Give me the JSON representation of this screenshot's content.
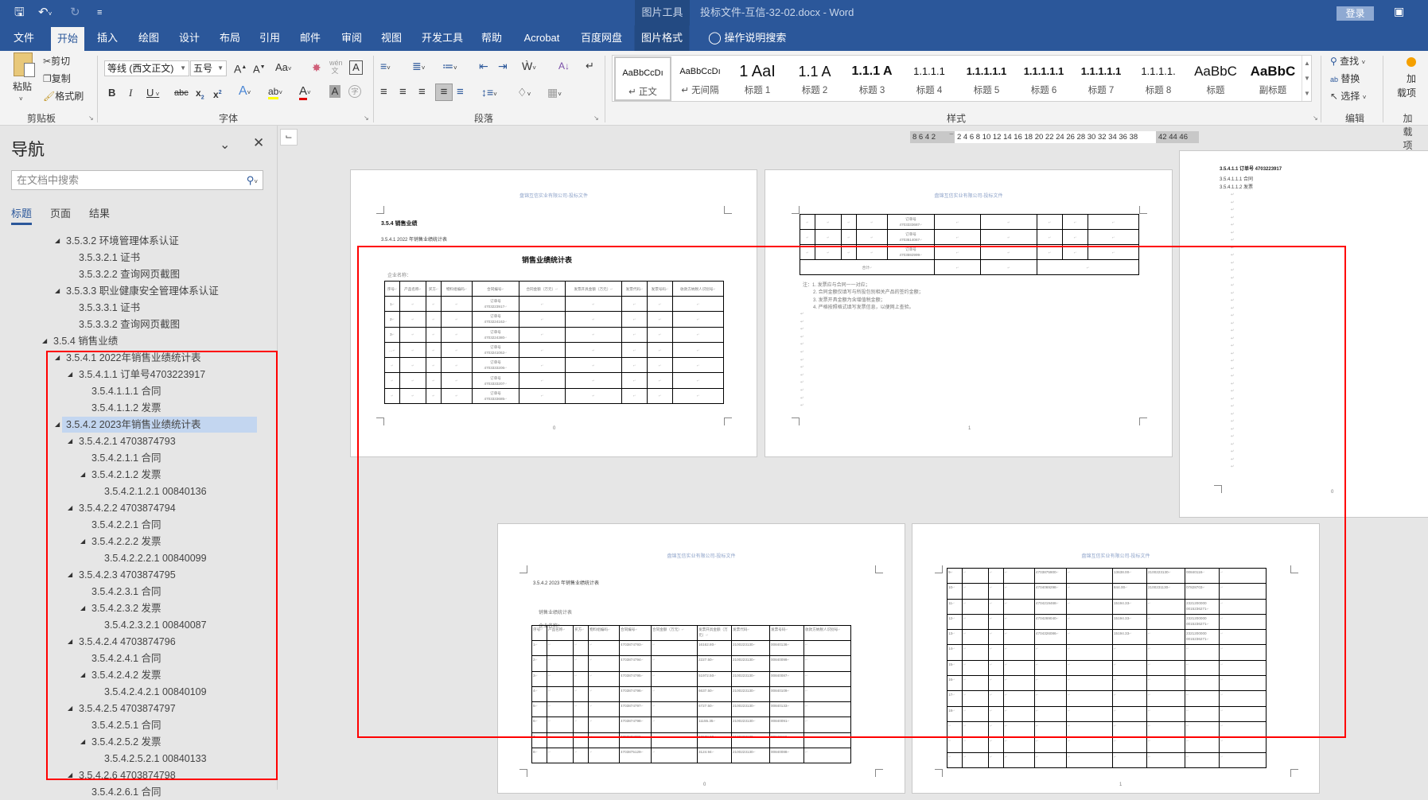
{
  "titlebar": {
    "context_tool": "图片工具",
    "doc_title": "投标文件-互信-32-02.docx  -  Word",
    "login": "登录"
  },
  "tabs": [
    "文件",
    "开始",
    "插入",
    "绘图",
    "设计",
    "布局",
    "引用",
    "邮件",
    "审阅",
    "视图",
    "开发工具",
    "帮助",
    "Acrobat",
    "百度网盘",
    "图片格式"
  ],
  "tell_me": "操作说明搜索",
  "ribbon": {
    "clipboard": {
      "label": "剪贴板",
      "paste": "粘贴",
      "cut": "剪切",
      "copy": "复制",
      "format_painter": "格式刷"
    },
    "font": {
      "label": "字体",
      "font_name": "等线 (西文正文)",
      "font_size": "五号"
    },
    "paragraph": {
      "label": "段落"
    },
    "styles": {
      "label": "样式",
      "items": [
        {
          "preview": "AaBbCcDı",
          "name": "正文"
        },
        {
          "preview": "AaBbCcDı",
          "name": "无间隔"
        },
        {
          "preview": "1  AaI",
          "name": "标题 1"
        },
        {
          "preview": "1.1  A",
          "name": "标题 2"
        },
        {
          "preview": "1.1.1  A",
          "name": "标题 3"
        },
        {
          "preview": "1.1.1.1",
          "name": "标题 4"
        },
        {
          "preview": "1.1.1.1.1",
          "name": "标题 5"
        },
        {
          "preview": "1.1.1.1.1",
          "name": "标题 6"
        },
        {
          "preview": "1.1.1.1.1",
          "name": "标题 7"
        },
        {
          "preview": "1.1.1.1.",
          "name": "标题 8"
        },
        {
          "preview": "AaBbC",
          "name": "标题"
        },
        {
          "preview": "AaBbC",
          "name": "副标题"
        }
      ]
    },
    "editing": {
      "label": "编辑",
      "find": "查找",
      "replace": "替换",
      "select": "选择"
    },
    "addins": {
      "label": "加载项",
      "button_line1": "加",
      "button_line2": "载项"
    }
  },
  "ruler": {
    "left": "8  6  4  2",
    "middle": "2  4  6  8  10 12 14 16 18 20 22 24 26 28 30 32 34 36 38",
    "right": "42 44 46"
  },
  "nav": {
    "title": "导航",
    "search_placeholder": "在文档中搜索",
    "tabs": [
      "标题",
      "页面",
      "结果"
    ],
    "items": [
      {
        "text": "3.5.3.2 环境管理体系认证",
        "depth": 1,
        "expandable": true
      },
      {
        "text": "3.5.3.2.1 证书",
        "depth": 2
      },
      {
        "text": "3.5.3.2.2 查询网页截图",
        "depth": 2
      },
      {
        "text": "3.5.3.3 职业健康安全管理体系认证",
        "depth": 1,
        "expandable": true
      },
      {
        "text": "3.5.3.3.1 证书",
        "depth": 2
      },
      {
        "text": "3.5.3.3.2 查询网页截图",
        "depth": 2
      },
      {
        "text": "3.5.4 销售业绩",
        "depth": 0,
        "expandable": true
      },
      {
        "text": "3.5.4.1 2022年销售业绩统计表",
        "depth": 1,
        "expandable": true
      },
      {
        "text": "3.5.4.1.1 订单号4703223917",
        "depth": 2,
        "expandable": true
      },
      {
        "text": "3.5.4.1.1.1 合同",
        "depth": 3
      },
      {
        "text": "3.5.4.1.1.2 发票",
        "depth": 3
      },
      {
        "text": "3.5.4.2 2023年销售业绩统计表",
        "depth": 1,
        "expandable": true,
        "selected": true
      },
      {
        "text": "3.5.4.2.1 4703874793",
        "depth": 2,
        "expandable": true
      },
      {
        "text": "3.5.4.2.1.1 合同",
        "depth": 3
      },
      {
        "text": "3.5.4.2.1.2 发票",
        "depth": 3,
        "expandable": true
      },
      {
        "text": "3.5.4.2.1.2.1 00840136",
        "depth": 4
      },
      {
        "text": "3.5.4.2.2 4703874794",
        "depth": 2,
        "expandable": true
      },
      {
        "text": "3.5.4.2.2.1 合同",
        "depth": 3
      },
      {
        "text": "3.5.4.2.2.2 发票",
        "depth": 3,
        "expandable": true
      },
      {
        "text": "3.5.4.2.2.2.1 00840099",
        "depth": 4
      },
      {
        "text": "3.5.4.2.3 4703874795",
        "depth": 2,
        "expandable": true
      },
      {
        "text": "3.5.4.2.3.1 合同",
        "depth": 3
      },
      {
        "text": "3.5.4.2.3.2 发票",
        "depth": 3,
        "expandable": true
      },
      {
        "text": "3.5.4.2.3.2.1 00840087",
        "depth": 4
      },
      {
        "text": "3.5.4.2.4 4703874796",
        "depth": 2,
        "expandable": true
      },
      {
        "text": "3.5.4.2.4.1 合同",
        "depth": 3
      },
      {
        "text": "3.5.4.2.4.2 发票",
        "depth": 3,
        "expandable": true
      },
      {
        "text": "3.5.4.2.4.2.1 00840109",
        "depth": 4
      },
      {
        "text": "3.5.4.2.5 4703874797",
        "depth": 2,
        "expandable": true
      },
      {
        "text": "3.5.4.2.5.1 合同",
        "depth": 3
      },
      {
        "text": "3.5.4.2.5.2 发票",
        "depth": 3,
        "expandable": true
      },
      {
        "text": "3.5.4.2.5.2.1 00840133",
        "depth": 4
      },
      {
        "text": "3.5.4.2.6 4703874798",
        "depth": 2,
        "expandable": true
      },
      {
        "text": "3.5.4.2.6.1 合同",
        "depth": 3
      }
    ]
  },
  "doc": {
    "header": "盘锦互信实业有限公司-投标文件",
    "page1": {
      "heading": "3.5.4   销售业绩",
      "subheading": "3.5.4.1   2022 年销售业绩统计表",
      "table_title": "销售业绩统计表",
      "company_label": "企业名称：",
      "page_number": "0",
      "table": {
        "head": [
          "序号",
          "产品名称",
          "买方",
          "物料组编码",
          "合同编号",
          "合同金额（万元）",
          "发票开具金额（万元）",
          "发票代码",
          "发票号码",
          "收款方纳税人识别号"
        ],
        "rows": [
          [
            "1",
            "",
            "",
            "",
            "订单号\n4703223917",
            "",
            "",
            "",
            "",
            ""
          ],
          [
            "2",
            "",
            "",
            "",
            "订单号\n4703224162",
            "",
            "",
            "",
            "",
            ""
          ],
          [
            "3",
            "",
            "",
            "",
            "订单号\n4703224380",
            "",
            "",
            "",
            "",
            ""
          ],
          [
            "…",
            "",
            "",
            "",
            "订单号\n4703241062",
            "",
            "",
            "",
            "",
            ""
          ],
          [
            "",
            "",
            "",
            "",
            "订单号\n4703333206",
            "",
            "",
            "",
            "",
            ""
          ],
          [
            "",
            "",
            "",
            "",
            "订单号\n4703333207",
            "",
            "",
            "",
            "",
            ""
          ],
          [
            "",
            "",
            "",
            "",
            "订单号\n4703333685",
            "",
            "",
            "",
            "",
            ""
          ]
        ]
      }
    },
    "page2": {
      "page_number": "1",
      "table": {
        "rows": [
          [
            "",
            "",
            "",
            "",
            "订单号\n4703333687",
            "",
            "",
            "",
            "",
            ""
          ],
          [
            "",
            "",
            "",
            "",
            "订单号\n4703514067",
            "",
            "",
            "",
            "",
            ""
          ],
          [
            "",
            "",
            "",
            "",
            "订单号\n4703592999",
            "",
            "",
            "",
            "",
            ""
          ]
        ],
        "total_label": "合计"
      },
      "notes": [
        "注：1. 发票应与合同一一对应；",
        "2. 合同金额仅填写与所投包别相关产品的签约金额；",
        "3. 发票开具金额为含增值税金额；",
        "4. 严格按照格式填写发票信息，以便网上查验。"
      ]
    },
    "page3": {
      "headings": [
        "3.5.4.1.1      订单号 4703223917",
        "3.5.4.1.1.1    合同",
        "3.5.4.1.1.2    发票"
      ],
      "page_number": "0"
    },
    "page4": {
      "heading": "3.5.4.2   2023 年销售业绩统计表",
      "table_title": "销售业绩统计表",
      "company_label": "企业名称：",
      "page_number": "0",
      "table": {
        "head": [
          "序号",
          "产品名称",
          "买方",
          "物料组编码",
          "合同编号",
          "合同金额（万元）",
          "发票开具金额（万元）",
          "发票代码",
          "发票号码",
          "收款方纳税人识别号"
        ],
        "rows": [
          [
            "1",
            "",
            "",
            "",
            "4703874793",
            "",
            "16162.80",
            "2100223130",
            "00840136",
            ""
          ],
          [
            "2",
            "",
            "",
            "",
            "4703874794",
            "",
            "2227.50",
            "2100223130",
            "00840099",
            ""
          ],
          [
            "3",
            "",
            "",
            "",
            "4703874795",
            "",
            "51972.50",
            "2100223130",
            "00840087",
            ""
          ],
          [
            "4",
            "",
            "",
            "",
            "4703874796",
            "",
            "6637.50",
            "2100223130",
            "00840109",
            ""
          ],
          [
            "5",
            "",
            "",
            "",
            "4703874797",
            "",
            "6727.50",
            "2100223130",
            "00840133",
            ""
          ],
          [
            "6",
            "",
            "",
            "",
            "4703874798",
            "",
            "11155.35",
            "2100223130",
            "00840091",
            ""
          ],
          [
            "7",
            "",
            "",
            "",
            "4703874799",
            "",
            "13638.00",
            "2100223130",
            "00840118",
            ""
          ],
          [
            "8",
            "",
            "",
            "",
            "4703875129",
            "",
            "3124.94",
            "2100223130",
            "00840088",
            ""
          ]
        ]
      }
    },
    "page5": {
      "page_number": "1",
      "table": {
        "rows": [
          [
            "9",
            "",
            "",
            "",
            "4703875900",
            "",
            "13638.00",
            "2100223130",
            "00840118",
            ""
          ],
          [
            "10",
            "",
            "",
            "",
            "4704069298",
            "",
            "844.00",
            "2100231130",
            "07828703",
            ""
          ],
          [
            "11",
            "",
            "",
            "",
            "4704219468",
            "",
            "15194.33",
            "",
            "2321200000\n0015236271",
            ""
          ],
          [
            "12",
            "",
            "",
            "",
            "4704269040",
            "",
            "15194.33",
            "",
            "2321200000\n0015236271",
            ""
          ],
          [
            "13",
            "",
            "",
            "",
            "4704326086",
            "",
            "15194.33",
            "",
            "2321200000\n0015236271",
            ""
          ],
          [
            "14",
            "",
            "",
            "",
            "",
            "",
            "",
            "",
            "",
            ""
          ],
          [
            "15",
            "",
            "",
            "",
            "",
            "",
            "",
            "",
            "",
            ""
          ],
          [
            "16",
            "",
            "",
            "",
            "",
            "",
            "",
            "",
            "",
            ""
          ],
          [
            "17",
            "",
            "",
            "",
            "",
            "",
            "",
            "",
            "",
            ""
          ],
          [
            "18",
            "",
            "",
            "",
            "",
            "",
            "",
            "",
            "",
            ""
          ],
          [
            "",
            "",
            "",
            "",
            "",
            "",
            "",
            "",
            "",
            ""
          ],
          [
            "",
            "",
            "",
            "",
            "",
            "",
            "",
            "",
            "",
            ""
          ],
          [
            "",
            "",
            "",
            "",
            "",
            "",
            "",
            "",
            "",
            ""
          ]
        ]
      }
    }
  },
  "colors": {
    "accent": "#2b579a",
    "context": "#234a82",
    "highlight": "#ff0000",
    "selected": "#c3d6f0"
  }
}
